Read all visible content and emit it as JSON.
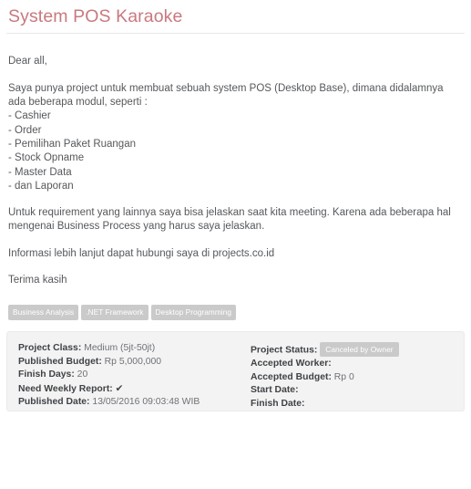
{
  "project": {
    "title": "System POS Karaoke",
    "description": {
      "greeting": "Dear all,",
      "intro": "Saya punya project untuk membuat sebuah system POS (Desktop Base), dimana didalamnya ada beberapa modul, seperti :",
      "modules": [
        "- Cashier",
        "- Order",
        "- Pemilihan Paket Ruangan",
        "- Stock Opname",
        "- Master Data",
        "- dan Laporan"
      ],
      "requirement": "Untuk requirement yang lainnya saya bisa jelaskan saat kita meeting. Karena ada beberapa hal mengenai Business Process yang harus saya jelaskan.",
      "contact": "Informasi lebih lanjut dapat hubungi saya di projects.co.id",
      "closing": "Terima kasih"
    },
    "tags": [
      "Business Analysis",
      ".NET Framework",
      "Desktop Programming"
    ],
    "details": {
      "left": [
        {
          "label": "Project Class:",
          "value": "Medium (5jt-50jt)"
        },
        {
          "label": "Published Budget:",
          "value": "Rp 5,000,000"
        },
        {
          "label": "Finish Days:",
          "value": "20"
        },
        {
          "label": "Need Weekly Report:",
          "value": "✔"
        },
        {
          "label": "Published Date:",
          "value": "13/05/2016 09:03:48 WIB"
        }
      ],
      "right": [
        {
          "label": "Project Status:",
          "value": "Canceled by Owner"
        },
        {
          "label": "Accepted Worker:",
          "value": ""
        },
        {
          "label": "Accepted Budget:",
          "value": "Rp 0"
        },
        {
          "label": "Start Date:",
          "value": ""
        },
        {
          "label": "Finish Date:",
          "value": ""
        }
      ]
    }
  },
  "colors": {
    "title": "#c9797f",
    "body_text": "#55585c",
    "tag_background": "#cacaca",
    "panel_background": "#f3f3f3",
    "status_badge_background": "#cacaca"
  }
}
